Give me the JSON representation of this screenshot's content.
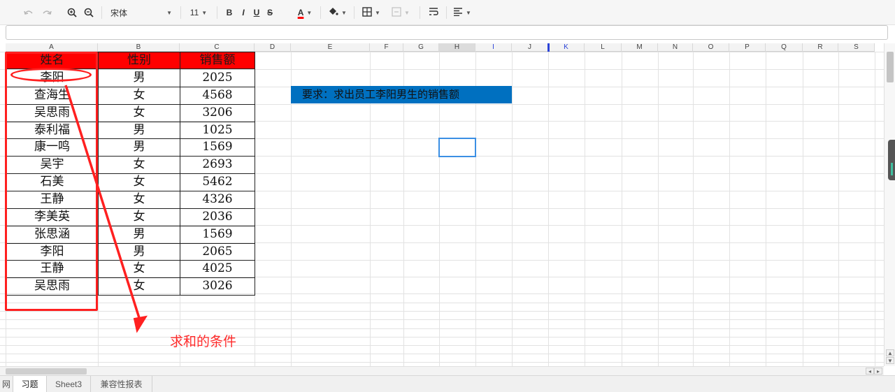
{
  "toolbar": {
    "undo_icon": "undo-icon",
    "redo_icon": "redo-icon",
    "zoom_in_icon": "zoom-in-icon",
    "zoom_out_icon": "zoom-out-icon",
    "font_name": "宋体",
    "font_size": "11",
    "bold": "B",
    "italic": "I",
    "underline": "U",
    "strike": "S",
    "font_color_letter": "A",
    "font_color": "#ff0000",
    "fill_icon": "paint-bucket-icon",
    "border_icon": "border-icon",
    "merge_icon": "merge-cells-icon",
    "wrap_icon": "wrap-text-icon",
    "align_icon": "align-left-icon"
  },
  "formula_bar": {
    "value": ""
  },
  "columns": [
    "A",
    "B",
    "C",
    "D",
    "E",
    "F",
    "G",
    "H",
    "I",
    "J",
    "K",
    "L",
    "M",
    "N",
    "O",
    "P",
    "Q",
    "R",
    "S"
  ],
  "selected_column": "H",
  "table": {
    "headers": [
      "姓名",
      "性别",
      "销售额"
    ],
    "header_fill": "#ff0000",
    "rows": [
      [
        "李阳",
        "男",
        "2025"
      ],
      [
        "查海生",
        "女",
        "4568"
      ],
      [
        "吴思雨",
        "女",
        "3206"
      ],
      [
        "泰利福",
        "男",
        "1025"
      ],
      [
        "康一鸣",
        "男",
        "1569"
      ],
      [
        "吴宇",
        "女",
        "2693"
      ],
      [
        "石美",
        "女",
        "5462"
      ],
      [
        "王静",
        "女",
        "4326"
      ],
      [
        "李美英",
        "女",
        "2036"
      ],
      [
        "张思涵",
        "男",
        "1569"
      ],
      [
        "李阳",
        "男",
        "2065"
      ],
      [
        "王静",
        "女",
        "4025"
      ],
      [
        "吴思雨",
        "女",
        "3026"
      ]
    ]
  },
  "note": {
    "text": "要求：求出员工李阳男生的销售额",
    "fill": "#0070c0"
  },
  "annotation": {
    "text": "求和的条件",
    "color": "#ff2020"
  },
  "sheet_tabs": [
    {
      "label": "网",
      "active": false
    },
    {
      "label": "习题",
      "active": true
    },
    {
      "label": "Sheet3",
      "active": false
    },
    {
      "label": "兼容性报表",
      "active": false
    }
  ],
  "scroll_arrows": {
    "up": "▲",
    "down": "▼",
    "left": "◂",
    "right": "▸"
  }
}
